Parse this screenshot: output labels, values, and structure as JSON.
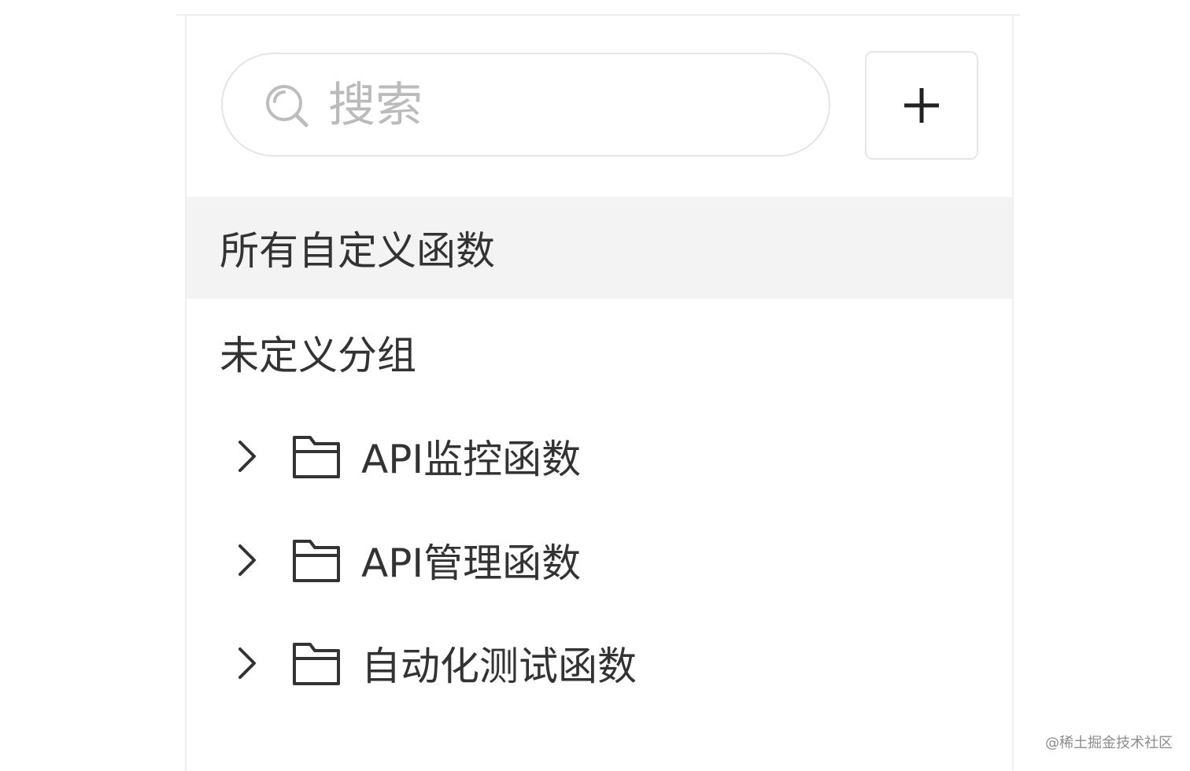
{
  "search": {
    "placeholder": "搜索",
    "icon": "search-icon"
  },
  "add_button": {
    "icon": "plus-icon"
  },
  "sidebar": {
    "all_functions_label": "所有自定义函数",
    "undefined_group_label": "未定义分组",
    "folders": [
      {
        "label": "API监控函数",
        "icon": "folder-icon",
        "expand_icon": "chevron-right-icon"
      },
      {
        "label": "API管理函数",
        "icon": "folder-icon",
        "expand_icon": "chevron-right-icon"
      },
      {
        "label": "自动化测试函数",
        "icon": "folder-icon",
        "expand_icon": "chevron-right-icon"
      }
    ]
  },
  "watermark": {
    "text": "@稀土掘金技术社区"
  },
  "colors": {
    "active_row_bg": "#f3f3f3",
    "text": "#333333",
    "placeholder": "#bbbbbb",
    "border": "#e5e5e5"
  }
}
